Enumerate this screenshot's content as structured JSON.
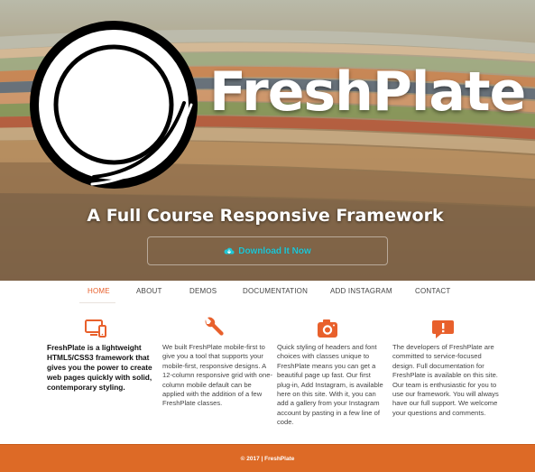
{
  "hero": {
    "brand": "FreshPlate",
    "tagline": "A Full Course Responsive Framework",
    "download_label": "Download It Now"
  },
  "nav": {
    "items": [
      {
        "label": "HOME",
        "active": true
      },
      {
        "label": "ABOUT",
        "active": false
      },
      {
        "label": "DEMOS",
        "active": false
      },
      {
        "label": "DOCUMENTATION",
        "active": false
      },
      {
        "label": "ADD INSTAGRAM",
        "active": false
      },
      {
        "label": "CONTACT",
        "active": false
      }
    ]
  },
  "features": [
    {
      "icon": "devices-icon",
      "text": "FreshPlate is a lightweight HTML5/CSS3 framework that gives you the power to create web pages quickly with solid, contemporary styling."
    },
    {
      "icon": "wrench-icon",
      "text": "We built FreshPlate mobile-first to give you a tool that supports your mobile-first, responsive designs. A 12-column responsive grid with one-column mobile default can be applied with the addition of a few FreshPlate classes."
    },
    {
      "icon": "camera-icon",
      "text": "Quick styling of headers and font choices with classes unique to FreshPlate means you can get a beautiful page up fast. Our first plug-in, Add Instagram, is available here on this site. With it, you can add a gallery from your Instagram account by pasting in a few line of code."
    },
    {
      "icon": "chat-alert-icon",
      "text": "The developers of FreshPlate are committed to service-focused design. Full documentation for FreshPlate is available on this site. Our team is enthusiastic for you to use our framework. You will always have our full support. We welcome your questions and comments."
    }
  ],
  "footer": {
    "text": "© 2017 | FreshPlate"
  },
  "colors": {
    "accent": "#e8602c",
    "footer_bg": "#dd6a26",
    "download_text": "#1fc7d6"
  }
}
